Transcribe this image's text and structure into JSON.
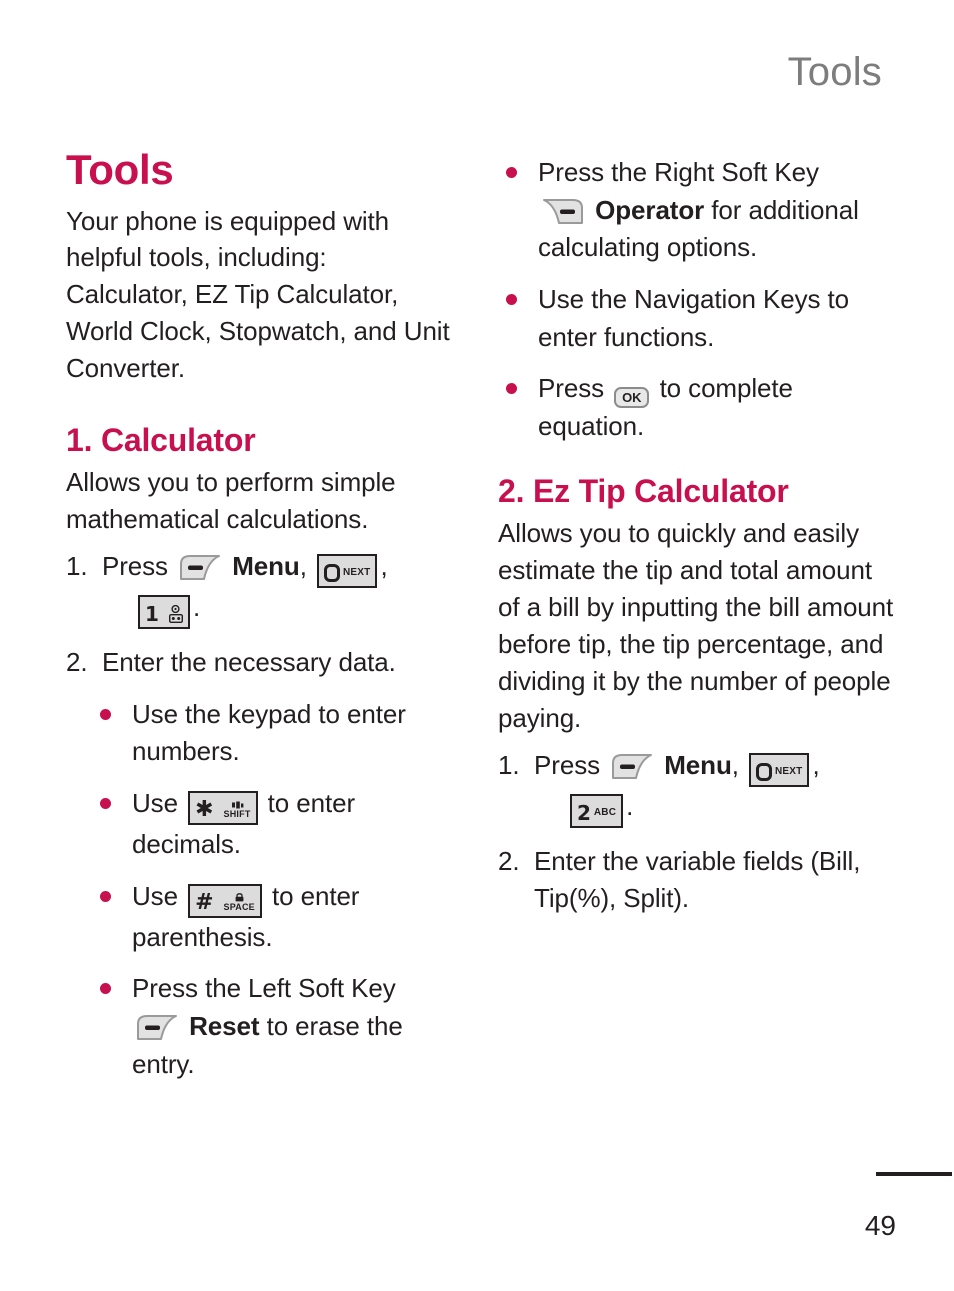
{
  "header": {
    "running_title": "Tools"
  },
  "colors": {
    "accent": "#C8104E",
    "header_gray": "#7D7D7D",
    "body_text": "#231F20",
    "keycap_fill": "#DCDCDC"
  },
  "left_column": {
    "chapter_title": "Tools",
    "intro_paragraph": "Your phone is equipped with helpful tools, including: Calculator, EZ Tip Calculator, World Clock, Stopwatch, and Unit Converter.",
    "section": {
      "title": "1. Calculator",
      "description": "Allows you to perform simple mathematical calculations.",
      "steps": [
        {
          "number": "1.",
          "text_before_softkey": "Press",
          "softkey_icon": "left-soft-key-icon",
          "label_bold": "Menu",
          "comma_1": ",",
          "key_next": {
            "digit": "0",
            "sublabel": "NEXT"
          },
          "comma_2": ",",
          "key_one": {
            "digit": "1",
            "sublabel": "voicemail-icon"
          },
          "period": "."
        },
        {
          "number": "2.",
          "text": "Enter the necessary data."
        }
      ],
      "bullets": [
        {
          "text": "Use the keypad to enter numbers."
        },
        {
          "prefix": "Use",
          "key": {
            "digit": "✳",
            "sublabel": "SHIFT",
            "icon": "shift-icon"
          },
          "suffix": "to enter decimals."
        },
        {
          "prefix": "Use",
          "key": {
            "digit": "#",
            "sublabel": "SPACE",
            "icon": "lock-icon"
          },
          "suffix": "to enter parenthesis."
        },
        {
          "prefix": "Press the Left Soft Key",
          "softkey_icon": "left-soft-key-icon",
          "label_bold": "Reset",
          "suffix": "to erase the entry."
        }
      ]
    }
  },
  "right_column": {
    "bullets": [
      {
        "prefix": "Press the Right Soft Key",
        "softkey_icon": "right-soft-key-icon",
        "label_bold": "Operator",
        "suffix": "for additional calculating options."
      },
      {
        "text": "Use the Navigation Keys to enter functions."
      },
      {
        "prefix": "Press",
        "ok_key": "OK",
        "suffix": "to complete equation."
      }
    ],
    "section": {
      "title": "2. Ez Tip Calculator",
      "description": "Allows you to quickly and easily estimate the tip and total amount of a bill by inputting the bill amount before tip, the tip percentage, and dividing it by the number of people paying.",
      "steps": [
        {
          "number": "1.",
          "text_before_softkey": "Press",
          "softkey_icon": "left-soft-key-icon",
          "label_bold": "Menu",
          "comma_1": ",",
          "key_next": {
            "digit": "0",
            "sublabel": "NEXT"
          },
          "comma_2": ",",
          "key_two": {
            "digit": "2",
            "sublabel": "ABC"
          },
          "period": "."
        },
        {
          "number": "2.",
          "text": "Enter the variable fields (Bill, Tip(%), Split)."
        }
      ]
    }
  },
  "footer": {
    "page_number": "49"
  }
}
